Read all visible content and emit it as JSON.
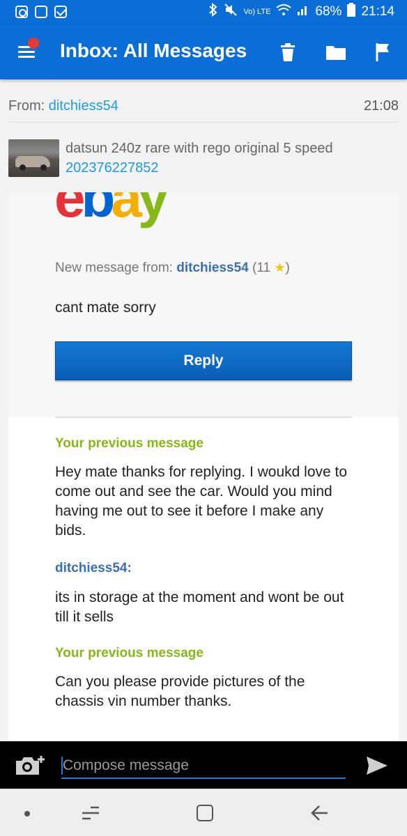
{
  "status_bar": {
    "battery": "68%",
    "time": "21:14",
    "network": "Vo) LTE"
  },
  "app_bar": {
    "title": "Inbox: All Messages",
    "icons": [
      "menu-icon",
      "delete-icon",
      "folder-icon",
      "flag-icon"
    ]
  },
  "header": {
    "from_label": "From: ",
    "from_user": "ditchiess54",
    "time": "21:08"
  },
  "item": {
    "title": "datsun 240z rare with rego original 5 speed",
    "number": "202376227852"
  },
  "email": {
    "new_message_label": "New message from: ",
    "sender": "ditchiess54",
    "feedback_open": " (11 ",
    "feedback_close": ")",
    "body": "cant mate sorry",
    "reply_label": "Reply"
  },
  "thread": [
    {
      "heading": "Your previous message",
      "body": "Hey mate thanks for replying. I woukd love to come out and see the car. Would you mind having me out to see it before I make any bids."
    },
    {
      "heading": "ditchiess54:",
      "body": "its in storage at the moment and wont be out till it sells"
    },
    {
      "heading": "Your previous message",
      "body": "Can you please provide pictures of the chassis vin number thanks."
    }
  ],
  "compose": {
    "placeholder": "Compose message"
  },
  "colors": {
    "app_blue": "#0b6ed6",
    "link_blue": "#1a9be6",
    "green": "#86b817",
    "notification_red": "#e53935"
  }
}
